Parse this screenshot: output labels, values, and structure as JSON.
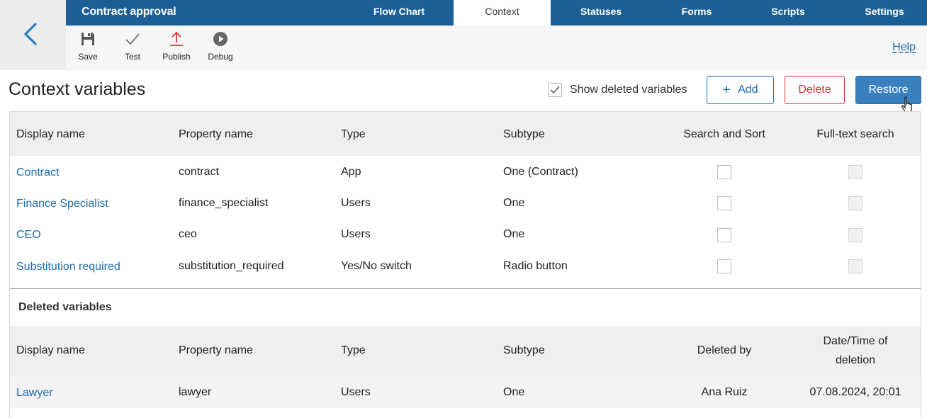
{
  "app": {
    "title": "Contract approval"
  },
  "tabs": [
    {
      "label": "Flow Chart"
    },
    {
      "label": "Context"
    },
    {
      "label": "Statuses"
    },
    {
      "label": "Forms"
    },
    {
      "label": "Scripts"
    },
    {
      "label": "Settings"
    }
  ],
  "active_tab": "Context",
  "toolbar": {
    "save": "Save",
    "test": "Test",
    "publish": "Publish",
    "debug": "Debug",
    "help": "Help"
  },
  "page": {
    "title": "Context variables",
    "show_deleted_label": "Show deleted variables",
    "show_deleted_checked": true,
    "add_label": "Add",
    "delete_label": "Delete",
    "restore_label": "Restore"
  },
  "variables_table": {
    "columns": [
      "Display name",
      "Property name",
      "Type",
      "Subtype",
      "Search and Sort",
      "Full-text search"
    ],
    "rows": [
      {
        "display_name": "Contract",
        "property_name": "contract",
        "type": "App",
        "subtype": "One (Contract)",
        "search_sort": false,
        "full_text": false
      },
      {
        "display_name": "Finance Specialist",
        "property_name": "finance_specialist",
        "type": "Users",
        "subtype": "One",
        "search_sort": false,
        "full_text": false
      },
      {
        "display_name": "CEO",
        "property_name": "ceo",
        "type": "Users",
        "subtype": "One",
        "search_sort": false,
        "full_text": false
      },
      {
        "display_name": "Substitution required",
        "property_name": "substitution_required",
        "type": "Yes/No switch",
        "subtype": "Radio button",
        "search_sort": false,
        "full_text": false
      }
    ]
  },
  "deleted_section": {
    "title": "Deleted variables",
    "columns": [
      "Display name",
      "Property name",
      "Type",
      "Subtype",
      "Deleted by",
      "Date/Time of",
      "deletion"
    ],
    "rows": [
      {
        "display_name": "Lawyer",
        "property_name": "lawyer",
        "type": "Users",
        "subtype": "One",
        "deleted_by": "Ana Ruiz",
        "deleted_at": "07.08.2024, 20:01"
      }
    ]
  },
  "colors": {
    "nav_blue": "#1b5f96",
    "link_blue": "#1b6db0",
    "danger_red": "#dd3333",
    "restore_blue": "#3a80bf"
  }
}
